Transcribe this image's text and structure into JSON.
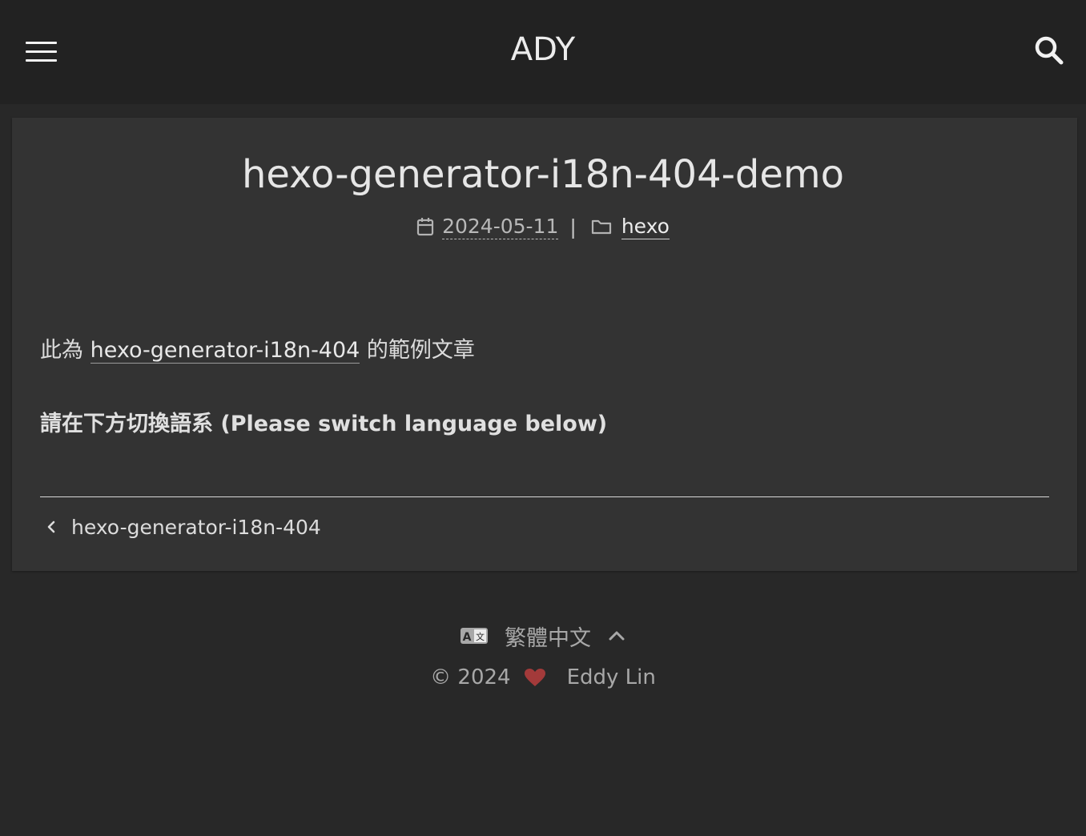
{
  "header": {
    "site_title": "ADY",
    "menu_icon": "hamburger-menu-icon",
    "search_icon": "search-icon"
  },
  "post": {
    "title": "hexo-generator-i18n-404-demo",
    "date": "2024-05-11",
    "separator": "|",
    "category": "hexo",
    "content": {
      "p1_prefix": "此為 ",
      "p1_link": "hexo-generator-i18n-404",
      "p1_suffix": " 的範例文章",
      "p2_bold": "請在下方切換語系 (Please switch language below)"
    },
    "prev_post": "hexo-generator-i18n-404"
  },
  "footer": {
    "language": "繁體中文",
    "copyright": "© 2024",
    "author": "Eddy Lin",
    "heart_color": "#a33a3a"
  },
  "colors": {
    "page_bg": "#282828",
    "header_bg": "#222222",
    "card_bg": "#333333"
  }
}
